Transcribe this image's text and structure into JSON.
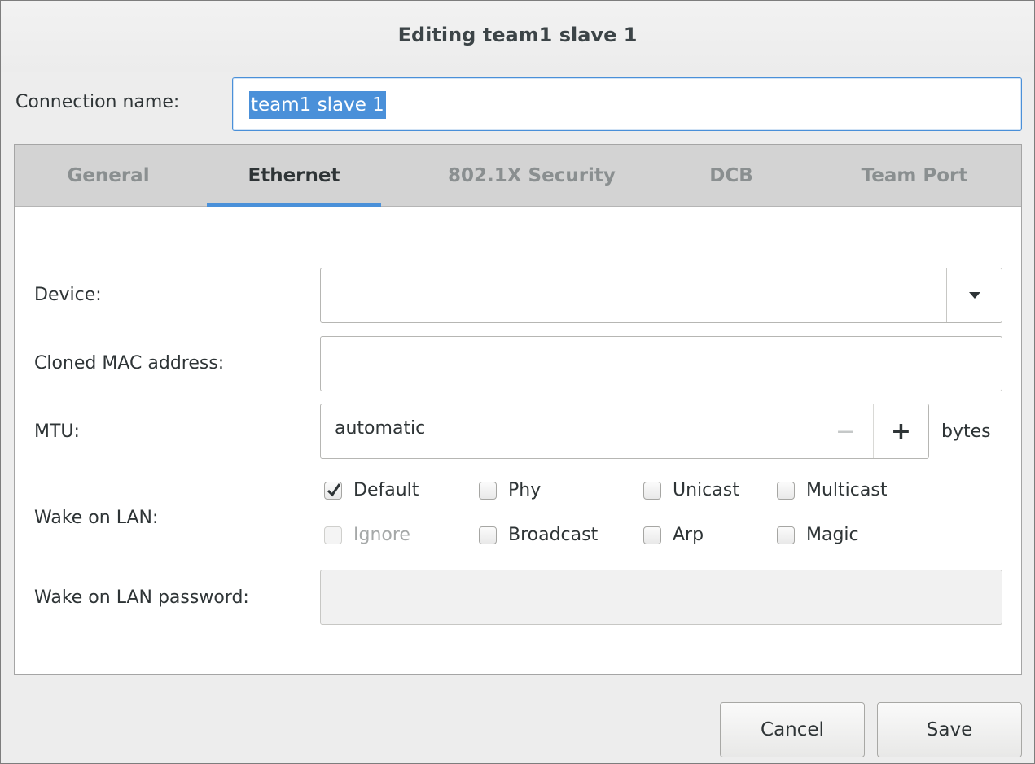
{
  "window": {
    "title": "Editing team1 slave 1"
  },
  "connection": {
    "label": "Connection name:",
    "value": "team1 slave 1"
  },
  "tabs": [
    {
      "label": "General",
      "active": false
    },
    {
      "label": "Ethernet",
      "active": true
    },
    {
      "label": "802.1X Security",
      "active": false
    },
    {
      "label": "DCB",
      "active": false
    },
    {
      "label": "Team Port",
      "active": false
    }
  ],
  "ethernet": {
    "device": {
      "label": "Device:",
      "value": ""
    },
    "cloned_mac": {
      "label": "Cloned MAC address:",
      "value": ""
    },
    "mtu": {
      "label": "MTU:",
      "value": "automatic",
      "minus": "−",
      "plus": "+",
      "unit": "bytes"
    },
    "wol": {
      "label": "Wake on LAN:",
      "options": [
        {
          "label": "Default",
          "checked": true,
          "enabled": true
        },
        {
          "label": "Phy",
          "checked": false,
          "enabled": true
        },
        {
          "label": "Unicast",
          "checked": false,
          "enabled": true
        },
        {
          "label": "Multicast",
          "checked": false,
          "enabled": true
        },
        {
          "label": "Ignore",
          "checked": false,
          "enabled": false
        },
        {
          "label": "Broadcast",
          "checked": false,
          "enabled": true
        },
        {
          "label": "Arp",
          "checked": false,
          "enabled": true
        },
        {
          "label": "Magic",
          "checked": false,
          "enabled": true
        }
      ]
    },
    "wol_password": {
      "label": "Wake on LAN password:",
      "value": ""
    }
  },
  "buttons": {
    "cancel": "Cancel",
    "save": "Save"
  },
  "colors": {
    "accent": "#4a90d9",
    "tab_bar": "#d3d3d3"
  }
}
